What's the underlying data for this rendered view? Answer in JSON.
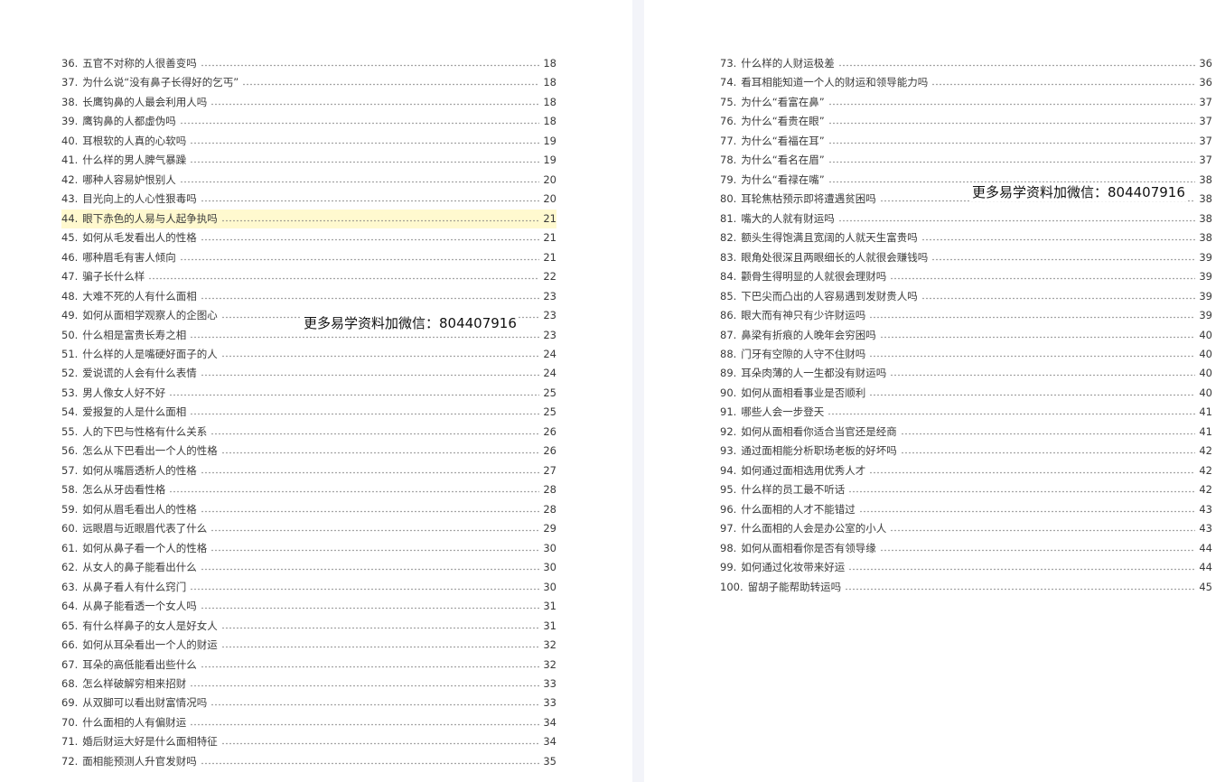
{
  "left_page": {
    "items": [
      {
        "num": "36.",
        "text": "五官不对称的人很善变吗",
        "page": "18"
      },
      {
        "num": "37.",
        "text": "为什么说“没有鼻子长得好的乞丐”",
        "page": "18"
      },
      {
        "num": "38.",
        "text": "长鹰钩鼻的人最会利用人吗",
        "page": "18"
      },
      {
        "num": "39.",
        "text": "鹰钩鼻的人都虚伪吗",
        "page": "18"
      },
      {
        "num": "40.",
        "text": "耳根软的人真的心软吗",
        "page": "19"
      },
      {
        "num": "41.",
        "text": "什么样的男人脾气暴躁",
        "page": "19"
      },
      {
        "num": "42.",
        "text": "哪种人容易妒恨别人",
        "page": "20"
      },
      {
        "num": "43.",
        "text": "目光向上的人心性狠毒吗",
        "page": "20"
      },
      {
        "num": "44.",
        "text": "眼下赤色的人易与人起争执吗",
        "page": "21",
        "highlight": true
      },
      {
        "num": "45.",
        "text": "如何从毛发看出人的性格",
        "page": "21"
      },
      {
        "num": "46.",
        "text": "哪种眉毛有害人倾向",
        "page": "21"
      },
      {
        "num": "47.",
        "text": "骗子长什么样",
        "page": "22"
      },
      {
        "num": "48.",
        "text": "大难不死的人有什么面相",
        "page": "23"
      },
      {
        "num": "49.",
        "text": "如何从面相学观察人的企图心",
        "page": "23"
      },
      {
        "num": "50.",
        "text": "什么相是富贵长寿之相",
        "page": "23"
      },
      {
        "num": "51.",
        "text": "什么样的人是嘴硬好面子的人",
        "page": "24"
      },
      {
        "num": "52.",
        "text": "爱说谎的人会有什么表情",
        "page": "24"
      },
      {
        "num": "53.",
        "text": "男人像女人好不好",
        "page": "25"
      },
      {
        "num": "54.",
        "text": "爱报复的人是什么面相",
        "page": "25"
      },
      {
        "num": "55.",
        "text": "人的下巴与性格有什么关系",
        "page": "26"
      },
      {
        "num": "56.",
        "text": "怎么从下巴看出一个人的性格",
        "page": "26"
      },
      {
        "num": "57.",
        "text": "如何从嘴唇透析人的性格",
        "page": "27"
      },
      {
        "num": "58.",
        "text": "怎么从牙齿看性格",
        "page": "28"
      },
      {
        "num": "59.",
        "text": "如何从眉毛看出人的性格",
        "page": "28"
      },
      {
        "num": "60.",
        "text": "远眼眉与近眼眉代表了什么",
        "page": "29"
      },
      {
        "num": "61.",
        "text": "如何从鼻子看一个人的性格",
        "page": "30"
      },
      {
        "num": "62.",
        "text": "从女人的鼻子能看出什么",
        "page": "30"
      },
      {
        "num": "63.",
        "text": "从鼻子看人有什么窍门",
        "page": "30"
      },
      {
        "num": "64.",
        "text": "从鼻子能看透一个女人吗",
        "page": "31"
      },
      {
        "num": "65.",
        "text": "有什么样鼻子的女人是好女人",
        "page": "31"
      },
      {
        "num": "66.",
        "text": "如何从耳朵看出一个人的财运",
        "page": "32"
      },
      {
        "num": "67.",
        "text": "耳朵的高低能看出些什么",
        "page": "32"
      },
      {
        "num": "68.",
        "text": "怎么样破解穷相来招财",
        "page": "33"
      },
      {
        "num": "69.",
        "text": "从双脚可以看出财富情况吗",
        "page": "33"
      },
      {
        "num": "70.",
        "text": "什么面相的人有偏财运",
        "page": "34"
      },
      {
        "num": "71.",
        "text": "婚后财运大好是什么面相特征",
        "page": "34"
      },
      {
        "num": "72.",
        "text": "面相能预测人升官发财吗",
        "page": "35"
      }
    ],
    "watermark": "更多易学资料加微信：804407916"
  },
  "right_page": {
    "items": [
      {
        "num": "73.",
        "text": "什么样的人财运极差",
        "page": "36"
      },
      {
        "num": "74.",
        "text": "看耳相能知道一个人的财运和领导能力吗",
        "page": "36"
      },
      {
        "num": "75.",
        "text": "为什么“看富在鼻”",
        "page": "37"
      },
      {
        "num": "76.",
        "text": "为什么“看贵在眼”",
        "page": "37"
      },
      {
        "num": "77.",
        "text": "为什么“看福在耳”",
        "page": "37"
      },
      {
        "num": "78.",
        "text": "为什么“看名在眉”",
        "page": "37"
      },
      {
        "num": "79.",
        "text": "为什么“看禄在嘴”",
        "page": "38"
      },
      {
        "num": "80.",
        "text": "耳轮焦枯预示即将遭遇贫困吗",
        "page": "38"
      },
      {
        "num": "81.",
        "text": "嘴大的人就有财运吗",
        "page": "38"
      },
      {
        "num": "82.",
        "text": "额头生得饱满且宽阔的人就天生富贵吗",
        "page": "38"
      },
      {
        "num": "83.",
        "text": "眼角处很深且两眼细长的人就很会赚钱吗",
        "page": "39"
      },
      {
        "num": "84.",
        "text": "颧骨生得明显的人就很会理财吗",
        "page": "39"
      },
      {
        "num": "85.",
        "text": "下巴尖而凸出的人容易遇到发财贵人吗",
        "page": "39"
      },
      {
        "num": "86.",
        "text": "眼大而有神只有少许财运吗",
        "page": "39"
      },
      {
        "num": "87.",
        "text": "鼻梁有折痕的人晚年会穷困吗",
        "page": "40"
      },
      {
        "num": "88.",
        "text": "门牙有空隙的人守不住财吗",
        "page": "40"
      },
      {
        "num": "89.",
        "text": "耳朵肉薄的人一生都没有财运吗",
        "page": "40"
      },
      {
        "num": "90.",
        "text": "如何从面相看事业是否顺利",
        "page": "40"
      },
      {
        "num": "91.",
        "text": "哪些人会一步登天",
        "page": "41"
      },
      {
        "num": "92.",
        "text": "如何从面相看你适合当官还是经商",
        "page": "41"
      },
      {
        "num": "93.",
        "text": "通过面相能分析职场老板的好坏吗",
        "page": "42"
      },
      {
        "num": "94.",
        "text": "如何通过面相选用优秀人才",
        "page": "42"
      },
      {
        "num": "95.",
        "text": "什么样的员工最不听话",
        "page": "42"
      },
      {
        "num": "96.",
        "text": "什么面相的人才不能错过",
        "page": "43"
      },
      {
        "num": "97.",
        "text": "什么面相的人会是办公室的小人",
        "page": "43"
      },
      {
        "num": "98.",
        "text": "如何从面相看你是否有领导缘",
        "page": "44"
      },
      {
        "num": "99.",
        "text": "如何通过化妆带来好运",
        "page": "44"
      },
      {
        "num": "100.",
        "text": "留胡子能帮助转运吗",
        "page": "45"
      }
    ],
    "watermark": "更多易学资料加微信：804407916"
  }
}
